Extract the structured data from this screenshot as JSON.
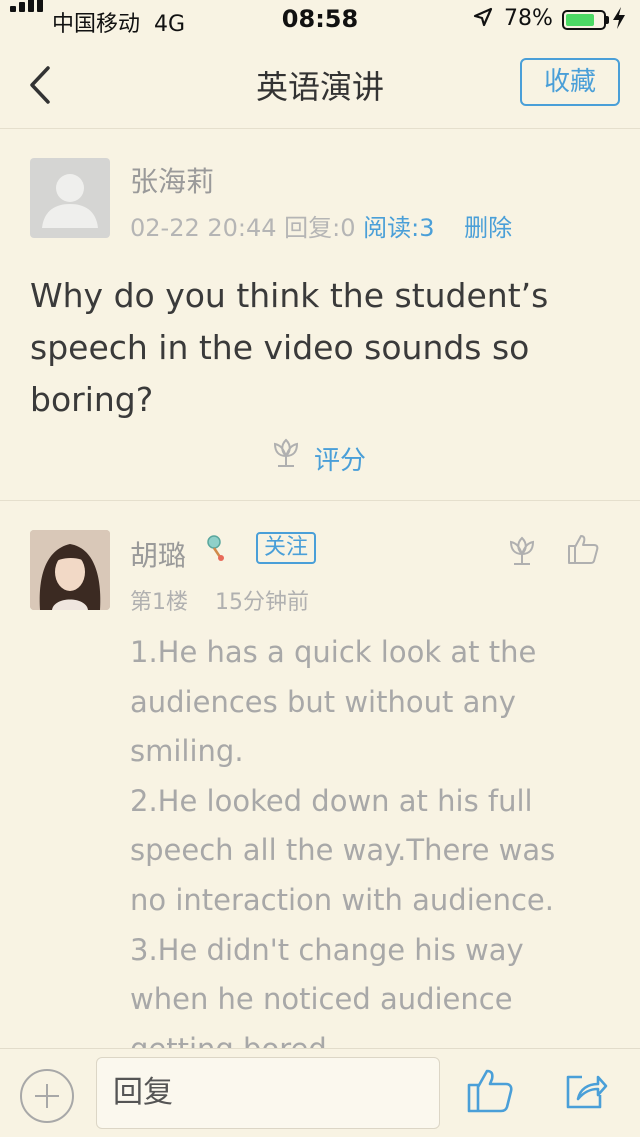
{
  "status_bar": {
    "carrier": "中国移动",
    "network": "4G",
    "time": "08:58",
    "battery_percent": "78%",
    "battery_level": 0.78
  },
  "nav": {
    "title": "英语演讲",
    "favorite_label": "收藏"
  },
  "post": {
    "author": "张海莉",
    "date": "02-22 20:44",
    "replies": "回复:0",
    "reads": "阅读:3",
    "delete_label": "删除",
    "question": "Why do you think the student’s speech in the video sounds so boring?",
    "rate_label": "评分"
  },
  "reply": {
    "author": "胡璐",
    "follow_label": "关注",
    "floor": "第1楼",
    "time_ago": "15分钟前",
    "lines": [
      "1.He has a quick look at the",
      "audiences but without any",
      "smiling.",
      "2.He looked down at his full",
      "speech all the way.There was",
      "no interaction with audience.",
      "3.He didn't change his way",
      "when he noticed audience",
      "getting bored."
    ]
  },
  "bottom_bar": {
    "reply_placeholder": "回复"
  },
  "colors": {
    "background": "#f8f3e3",
    "accent": "#4a9fd8",
    "battery": "#4cd964"
  }
}
